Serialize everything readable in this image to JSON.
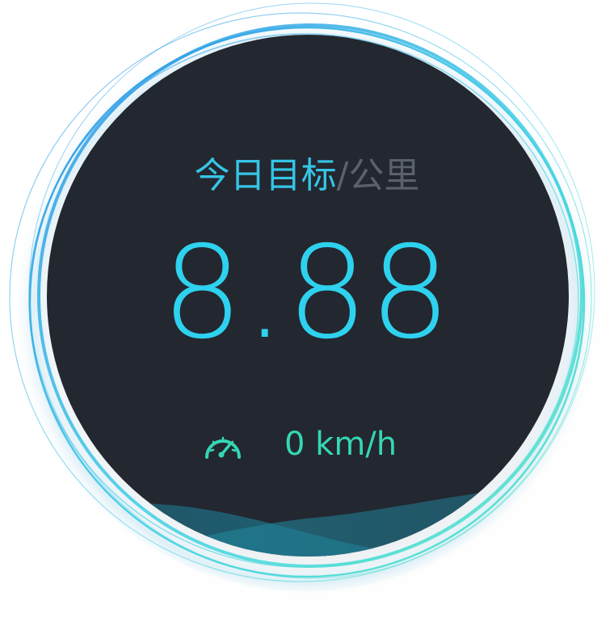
{
  "goal": {
    "label": "今日目标",
    "unit": "/公里",
    "value": "8.88"
  },
  "speed": {
    "icon": "speedometer-icon",
    "text": "0 km/h"
  },
  "colors": {
    "dial_background": "#23272f",
    "accent_cyan": "#2ed1ee",
    "accent_green": "#35d7b4",
    "ring_blue": "#2f8fe0",
    "unit_gray": "#5b616b"
  }
}
